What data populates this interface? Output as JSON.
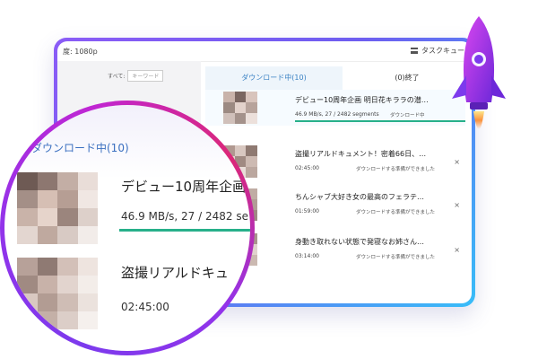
{
  "window": {
    "quality": "度: 1080p",
    "task_queue": "タスクキュー"
  },
  "left": {
    "filter_all": "すべて:",
    "keyword_placeholder": "キーワード"
  },
  "tabs": {
    "downloading": "ダウンロード中(10)",
    "finished": "(0)終了"
  },
  "rows": [
    {
      "title": "デビュー10周年企画 明日花キララの潜…",
      "meta": "46.9 MB/s, 27 / 2482 segments",
      "status": "ダウンロード中",
      "progress": 0.011
    },
    {
      "title": "盗撮リアルドキュメント！密着66日、…",
      "meta": "02:45:00",
      "status": "ダウンロードする準備ができました"
    },
    {
      "title": "ちんシャブ大好き女の最高のフェラテ…",
      "meta": "01:59:00",
      "status": "ダウンロードする準備ができました"
    },
    {
      "title": "身動き取れない状態で発寝なお姉さん…",
      "meta": "03:14:00",
      "status": "ダウンロードする準備ができました"
    }
  ],
  "close_glyph": "×",
  "magnifier": {
    "section": "ダウンロード中(10)",
    "item1_title": "デビュー10周年企画",
    "item1_meta": "46.9 MB/s, 27 / 2482 se",
    "item2_title": "盗撮リアルドキュ",
    "item2_meta": "02:45:00"
  },
  "colors": {
    "accent_blue": "#3b82c4",
    "progress_green": "#27b08a",
    "ring_purple": "#9333ea",
    "ring_magenta": "#c026d3"
  },
  "icons": [
    "list-icon",
    "close-icon",
    "rocket-icon"
  ]
}
